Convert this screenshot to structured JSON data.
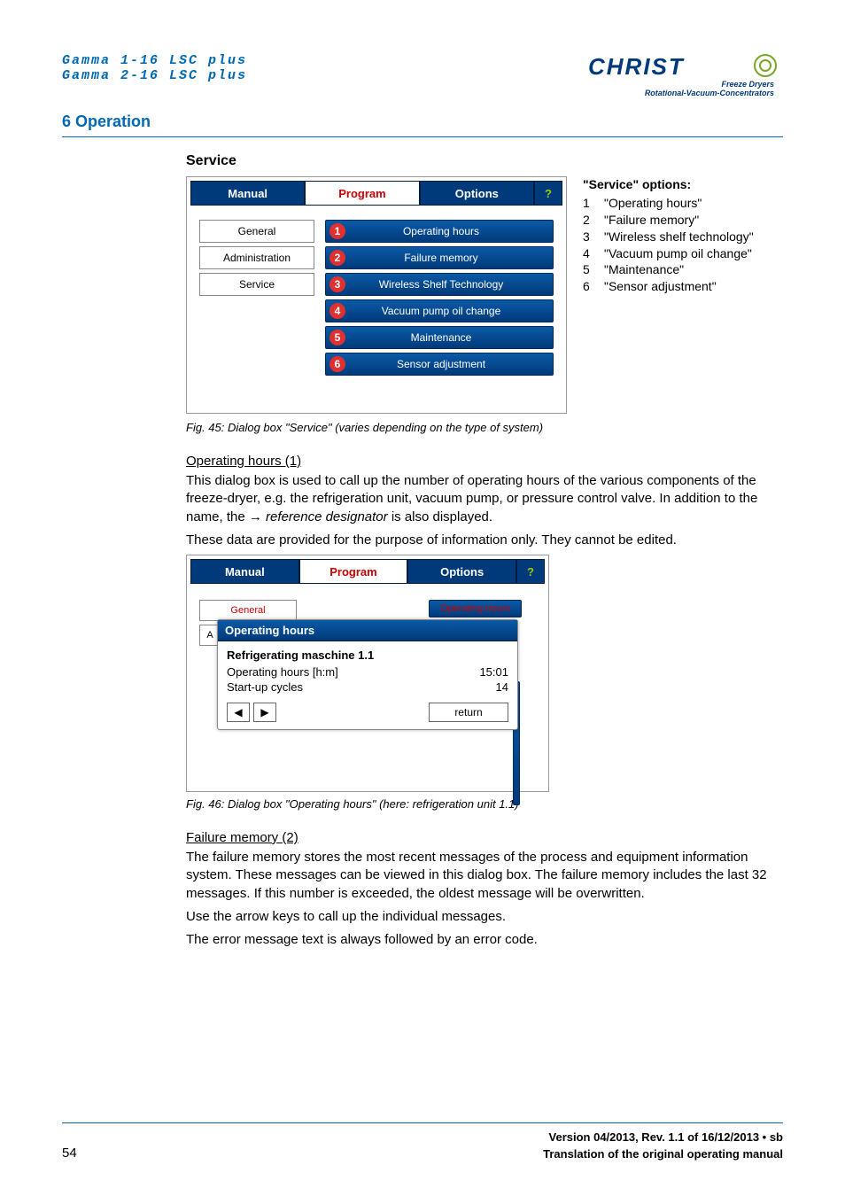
{
  "header": {
    "product_lines": [
      "Gamma 1-16 LSC plus",
      "Gamma 2-16 LSC plus"
    ],
    "logo_brand": "CHRIST",
    "logo_sub1": "Freeze Dryers",
    "logo_sub2": "Rotational-Vacuum-Concentrators",
    "section": "6 Operation"
  },
  "service": {
    "heading": "Service",
    "tabs": {
      "manual": "Manual",
      "program": "Program",
      "options": "Options",
      "help": "?"
    },
    "sidebar": [
      "General",
      "Administration",
      "Service"
    ],
    "menu": [
      "Operating hours",
      "Failure memory",
      "Wireless Shelf Technology",
      "Vacuum pump oil change",
      "Maintenance",
      "Sensor adjustment"
    ],
    "legend_title": "\"Service\" options:",
    "legend": [
      {
        "n": "1",
        "t": "\"Operating hours\""
      },
      {
        "n": "2",
        "t": "\"Failure memory\""
      },
      {
        "n": "3",
        "t": "\"Wireless shelf technology\""
      },
      {
        "n": "4",
        "t": "\"Vacuum pump oil change\""
      },
      {
        "n": "5",
        "t": "\"Maintenance\""
      },
      {
        "n": "6",
        "t": "\"Sensor adjustment\""
      }
    ],
    "caption": "Fig. 45: Dialog box \"Service\" (varies depending on the type of system)"
  },
  "op_hours": {
    "heading": "Operating hours (1)",
    "para1a": "This dialog box is used to call up the number of operating hours of the various components of the freeze-dryer, e.g. the refrigeration unit, vacuum pump, or pressure control valve. In addition to the name, the ",
    "para1_arrow": "→",
    "para1_ref": " reference designator",
    "para1b": " is also displayed.",
    "para2": "These data are provided for the purpose of information only. They cannot be edited.",
    "dialog": {
      "ghost_general": "General",
      "ghost_a": "A",
      "ghost_title": "Operating hours",
      "float_title": "Operating hours",
      "row_title": "Refrigerating maschine 1.1",
      "row1_k": "Operating hours [h:m]",
      "row1_v": "15:01",
      "row2_k": "Start-up cycles",
      "row2_v": "14",
      "return": "return",
      "prev": "◀",
      "next": "▶"
    },
    "caption": "Fig. 46: Dialog box \"Operating hours\" (here: refrigeration unit 1.1)"
  },
  "failure": {
    "heading": "Failure memory (2)",
    "para1": "The failure memory stores the most recent messages of the process and equipment information system. These messages can be viewed in this dialog box. The failure memory includes the last 32 messages. If this number is exceeded, the oldest message will be overwritten.",
    "para2": "Use the arrow keys to call up the individual messages.",
    "para3": "The error message text is always followed by an error code."
  },
  "footer": {
    "page": "54",
    "version": "Version 04/2013, Rev. 1.1 of 16/12/2013 • sb",
    "translation": "Translation of the original operating manual"
  }
}
